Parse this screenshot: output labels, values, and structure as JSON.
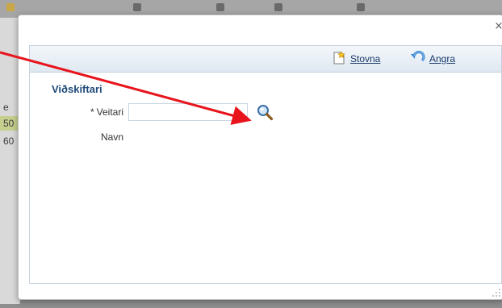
{
  "dialog": {
    "close_symbol": "×",
    "toolbar": {
      "create_label": "Stovna",
      "undo_label": "Angra"
    },
    "section_title": "Viðskiftari",
    "fields": {
      "supplier": {
        "required_marker": "*",
        "label": "Veitari",
        "value": ""
      },
      "name": {
        "label": "Navn"
      }
    }
  },
  "background": {
    "row_fragments": [
      "e",
      "50",
      "60"
    ]
  },
  "annotation": {
    "arrow_color": "#e8141c"
  },
  "icons": {
    "create": "new-document-star-icon",
    "undo": "undo-arrow-icon",
    "search": "magnifier-icon",
    "close": "close-icon"
  }
}
